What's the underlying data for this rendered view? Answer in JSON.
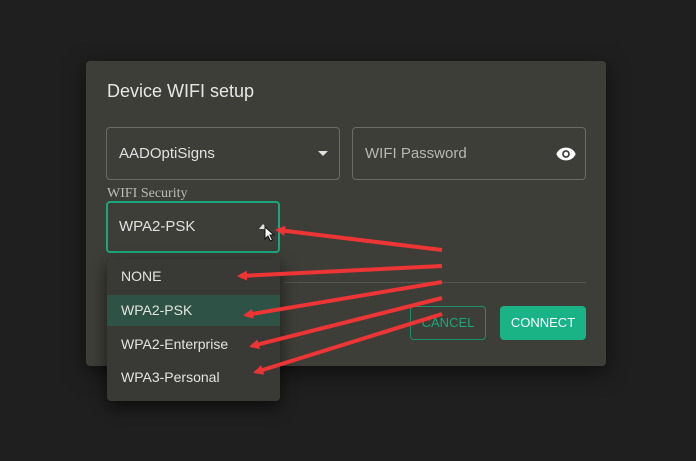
{
  "dialog": {
    "title": "Device WIFI setup",
    "ssid_value": "AADOptiSigns",
    "password_placeholder": "WIFI Password",
    "security_label": "WIFI Security",
    "security_value": "WPA2-PSK",
    "cancel_label": "CANCEL",
    "connect_label": "CONNECT"
  },
  "dropdown": {
    "options": [
      {
        "label": "NONE",
        "selected": false
      },
      {
        "label": "WPA2-PSK",
        "selected": true
      },
      {
        "label": "WPA2-Enterprise",
        "selected": false
      },
      {
        "label": "WPA3-Personal",
        "selected": false
      }
    ]
  },
  "icons": [
    "chevron-down-icon",
    "eye-icon",
    "chevron-up-icon",
    "mouse-cursor-icon",
    "red-arrow-annotation"
  ],
  "colors": {
    "accent": "#19b386",
    "selected_option": "#2e5245",
    "dialog_bg": "#3e3e38",
    "annotation": "#ee3535"
  }
}
